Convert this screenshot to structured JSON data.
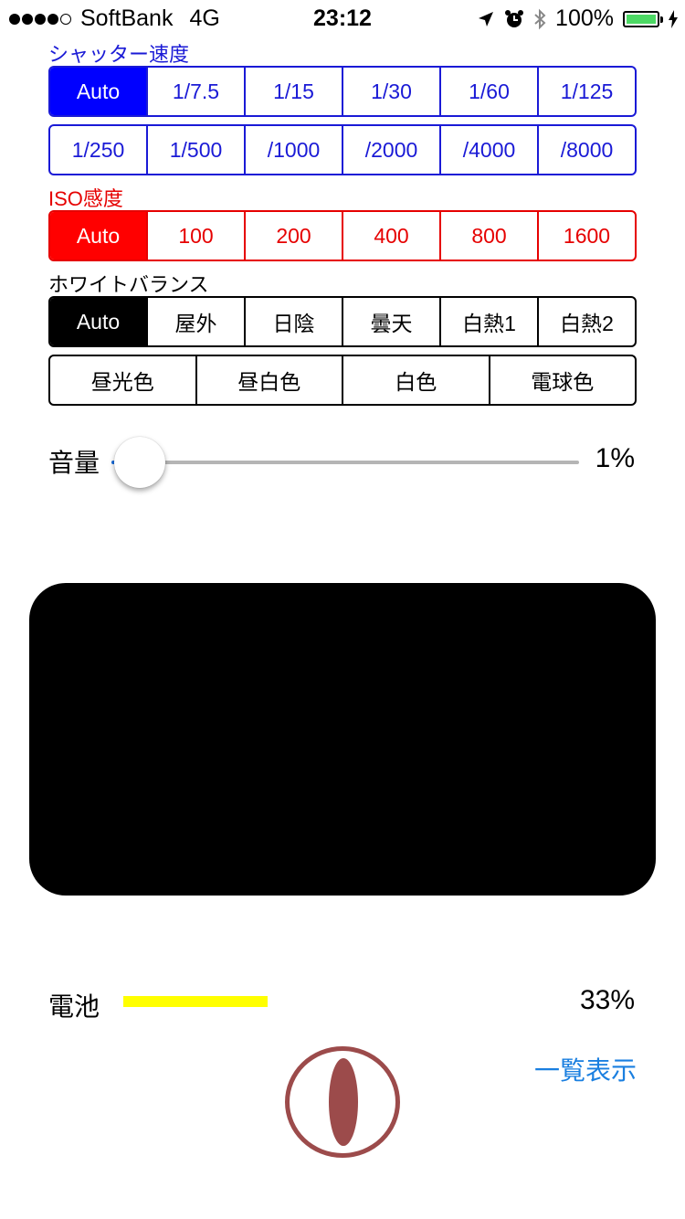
{
  "status_bar": {
    "carrier": "SoftBank",
    "network": "4G",
    "time": "23:12",
    "battery_percent": "100%",
    "signal_bars": 4
  },
  "shutter": {
    "label": "シャッター速度",
    "row1": [
      "Auto",
      "1/7.5",
      "1/15",
      "1/30",
      "1/60",
      "1/125"
    ],
    "row2": [
      "1/250",
      "1/500",
      "/1000",
      "/2000",
      "/4000",
      "/8000"
    ],
    "selected": "Auto",
    "color": "#0000ff"
  },
  "iso": {
    "label": "ISO感度",
    "options": [
      "Auto",
      "100",
      "200",
      "400",
      "800",
      "1600"
    ],
    "selected": "Auto",
    "color": "#ff0000"
  },
  "white_balance": {
    "label": "ホワイトバランス",
    "row1": [
      "Auto",
      "屋外",
      "日陰",
      "曇天",
      "白熱1",
      "白熱2"
    ],
    "row2": [
      "昼光色",
      "昼白色",
      "白色",
      "電球色"
    ],
    "selected": "Auto"
  },
  "volume": {
    "label": "音量",
    "value": "1%",
    "level": 0.01
  },
  "battery": {
    "label": "電池",
    "value": "33%",
    "level": 0.33,
    "color": "#ffff00"
  },
  "list_link": "一覧表示",
  "shutter_button_color": "#9c4b4b"
}
